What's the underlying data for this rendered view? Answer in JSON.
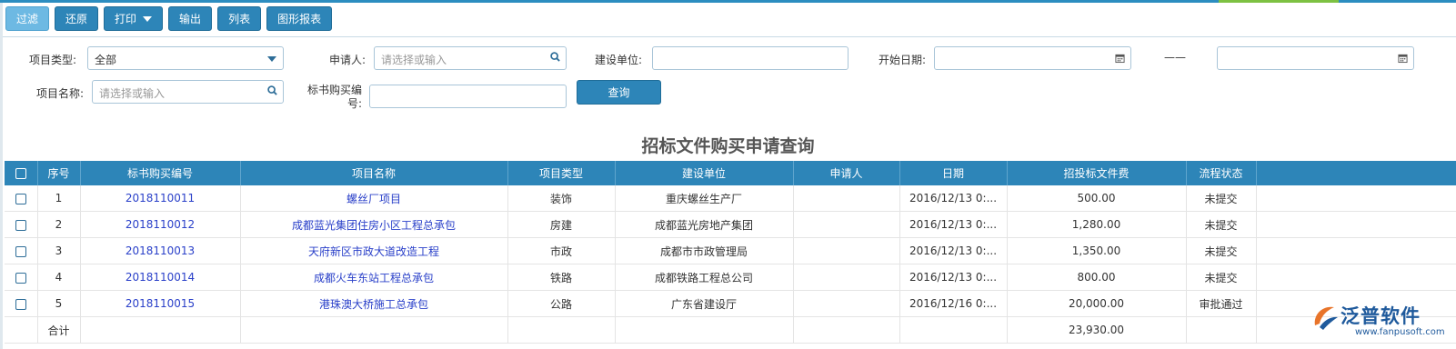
{
  "toolbar": {
    "filter": "过滤",
    "restore": "还原",
    "print": "打印",
    "export": "输出",
    "list": "列表",
    "chart_report": "图形报表"
  },
  "filters": {
    "project_type_label": "项目类型:",
    "project_type_value": "全部",
    "applicant_label": "申请人:",
    "applicant_placeholder": "请选择或输入",
    "construction_unit_label": "建设单位:",
    "construction_unit_value": "",
    "start_date_label": "开始日期:",
    "date_separator": "——",
    "start_date_from": "",
    "start_date_to": "",
    "project_name_label": "项目名称:",
    "project_name_placeholder": "请选择或输入",
    "tender_no_label_1": "标书购买编",
    "tender_no_label_2": "号:",
    "tender_no_value": "",
    "query_button": "查询"
  },
  "report_title": "招标文件购买申请查询",
  "table": {
    "columns": [
      "序号",
      "标书购买编号",
      "项目名称",
      "项目类型",
      "建设单位",
      "申请人",
      "日期",
      "招投标文件费",
      "流程状态"
    ],
    "rows": [
      {
        "no": "1",
        "code": "2018110011",
        "name": "螺丝厂项目",
        "type": "装饰",
        "unit": "重庆螺丝生产厂",
        "applicant": "",
        "date": "2016/12/13 0:...",
        "fee": "500.00",
        "status": "未提交"
      },
      {
        "no": "2",
        "code": "2018110012",
        "name": "成都蓝光集团住房小区工程总承包",
        "type": "房建",
        "unit": "成都蓝光房地产集团",
        "applicant": "",
        "date": "2016/12/13 0:...",
        "fee": "1,280.00",
        "status": "未提交"
      },
      {
        "no": "3",
        "code": "2018110013",
        "name": "天府新区市政大道改造工程",
        "type": "市政",
        "unit": "成都市市政管理局",
        "applicant": "",
        "date": "2016/12/13 0:...",
        "fee": "1,350.00",
        "status": "未提交"
      },
      {
        "no": "4",
        "code": "2018110014",
        "name": "成都火车东站工程总承包",
        "type": "铁路",
        "unit": "成都铁路工程总公司",
        "applicant": "",
        "date": "2016/12/13 0:...",
        "fee": "800.00",
        "status": "未提交"
      },
      {
        "no": "5",
        "code": "2018110015",
        "name": "港珠澳大桥施工总承包",
        "type": "公路",
        "unit": "广东省建设厅",
        "applicant": "",
        "date": "2016/12/16 0:...",
        "fee": "20,000.00",
        "status": "审批通过"
      }
    ],
    "total_label": "合计",
    "total_fee": "23,930.00"
  },
  "logo": {
    "name": "泛普软件",
    "url": "www.fanpusoft.com"
  },
  "colors": {
    "accent": "#2d85b8",
    "link": "#2a40c9",
    "brand": "#1f5a9c"
  }
}
